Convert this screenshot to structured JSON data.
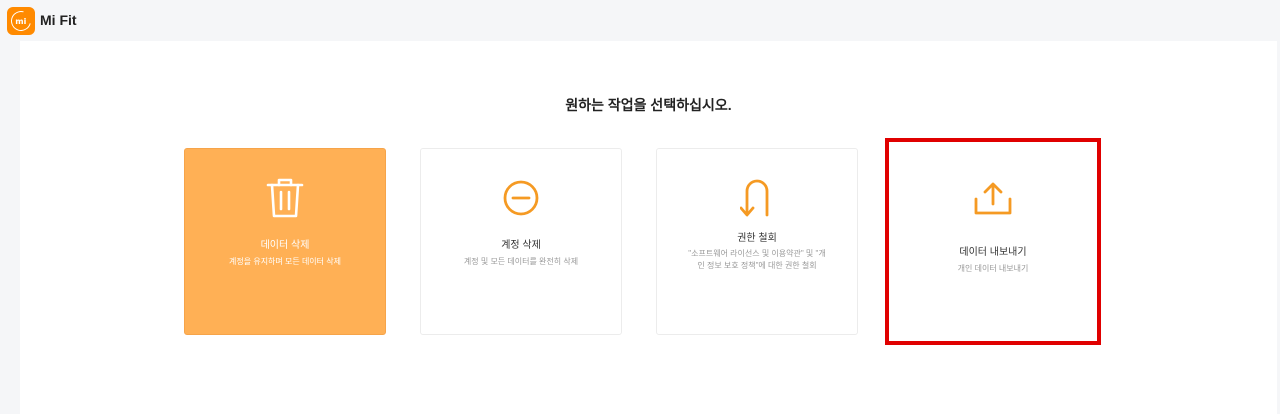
{
  "app": {
    "name": "Mi Fit",
    "logo_text": "mi"
  },
  "heading": "원하는 작업을 선택하십시오.",
  "options": [
    {
      "title": "데이터 삭제",
      "desc": "계정을 유지하며 모든 데이터 삭제"
    },
    {
      "title": "계정 삭제",
      "desc": "계정 및 모든 데이터를 완전히 삭제"
    },
    {
      "title": "권한 철회",
      "desc": "\"소프트웨어 라이선스 및 이용약관\" 및 \"개인 정보 보호 정책\"에 대한 권한 철회"
    },
    {
      "title": "데이터 내보내기",
      "desc": "개인 데이터 내보내기"
    }
  ],
  "colors": {
    "accent": "#ff8a00",
    "active_card": "#ffb055",
    "icon": "#f59a23",
    "highlight": "#e00000"
  }
}
